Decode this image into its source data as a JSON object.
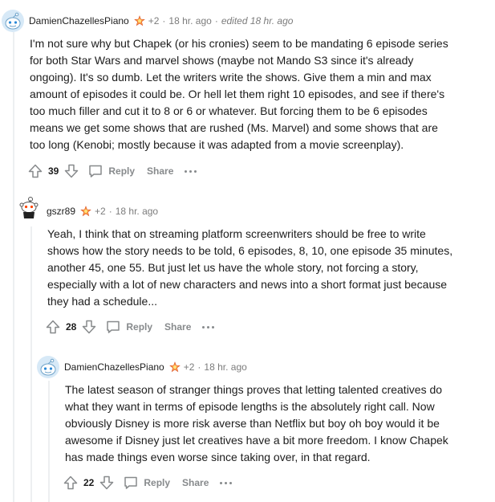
{
  "comments": [
    {
      "author": "DamienChazellesPiano",
      "award_count": "+2",
      "time": "18 hr. ago",
      "edited": "edited 18 hr. ago",
      "lines": [
        "I'm not sure why but Chapek (or his cronies) seem to be mandating 6 episode series",
        "for both Star Wars and marvel shows (maybe not Mando S3 since it's already",
        "ongoing). It's so dumb. Let the writers write the shows. Give them a min and max",
        "amount of episodes it could be. Or hell let them right 10 episodes, and see if there's",
        "too much filler and cut it to 8 or 6 or whatever. But forcing them to be 6 episodes",
        "means we get some shows that are rushed (Ms. Marvel) and some shows that are",
        "too long (Kenobi; mostly because it was adapted from a movie screenplay)."
      ],
      "score": "39",
      "reply_label": "Reply",
      "share_label": "Share"
    },
    {
      "author": "gszr89",
      "award_count": "+2",
      "time": "18 hr. ago",
      "lines": [
        "Yeah, I think that on streaming platform screenwriters should be free to write",
        "shows how the story needs to be told, 6 episodes, 8, 10, one episode 35 minutes,",
        "another 45, one 55. But just let us have the whole story, not forcing a story,",
        "especially with a lot of new characters and news into a short format just because",
        "they had a schedule..."
      ],
      "score": "28",
      "reply_label": "Reply",
      "share_label": "Share"
    },
    {
      "author": "DamienChazellesPiano",
      "award_count": "+2",
      "time": "18 hr. ago",
      "lines": [
        "The latest season of stranger things proves that letting talented creatives do",
        "what they want in terms of episode lengths is the absolutely right call. Now",
        "obviously Disney is more risk averse than Netflix but boy oh boy would it be",
        "awesome if Disney just let creatives have a bit more freedom. I know Chapek",
        "has made things even worse since taking over, in that regard."
      ],
      "score": "22",
      "reply_label": "Reply",
      "share_label": "Share"
    }
  ],
  "colors": {
    "meta_gray": "#7c7c7c",
    "action_gray": "#878a8c",
    "thread_line": "#edeff1",
    "snoo_blue": "#46d160",
    "avatar_bg": "#d7e9f7"
  }
}
